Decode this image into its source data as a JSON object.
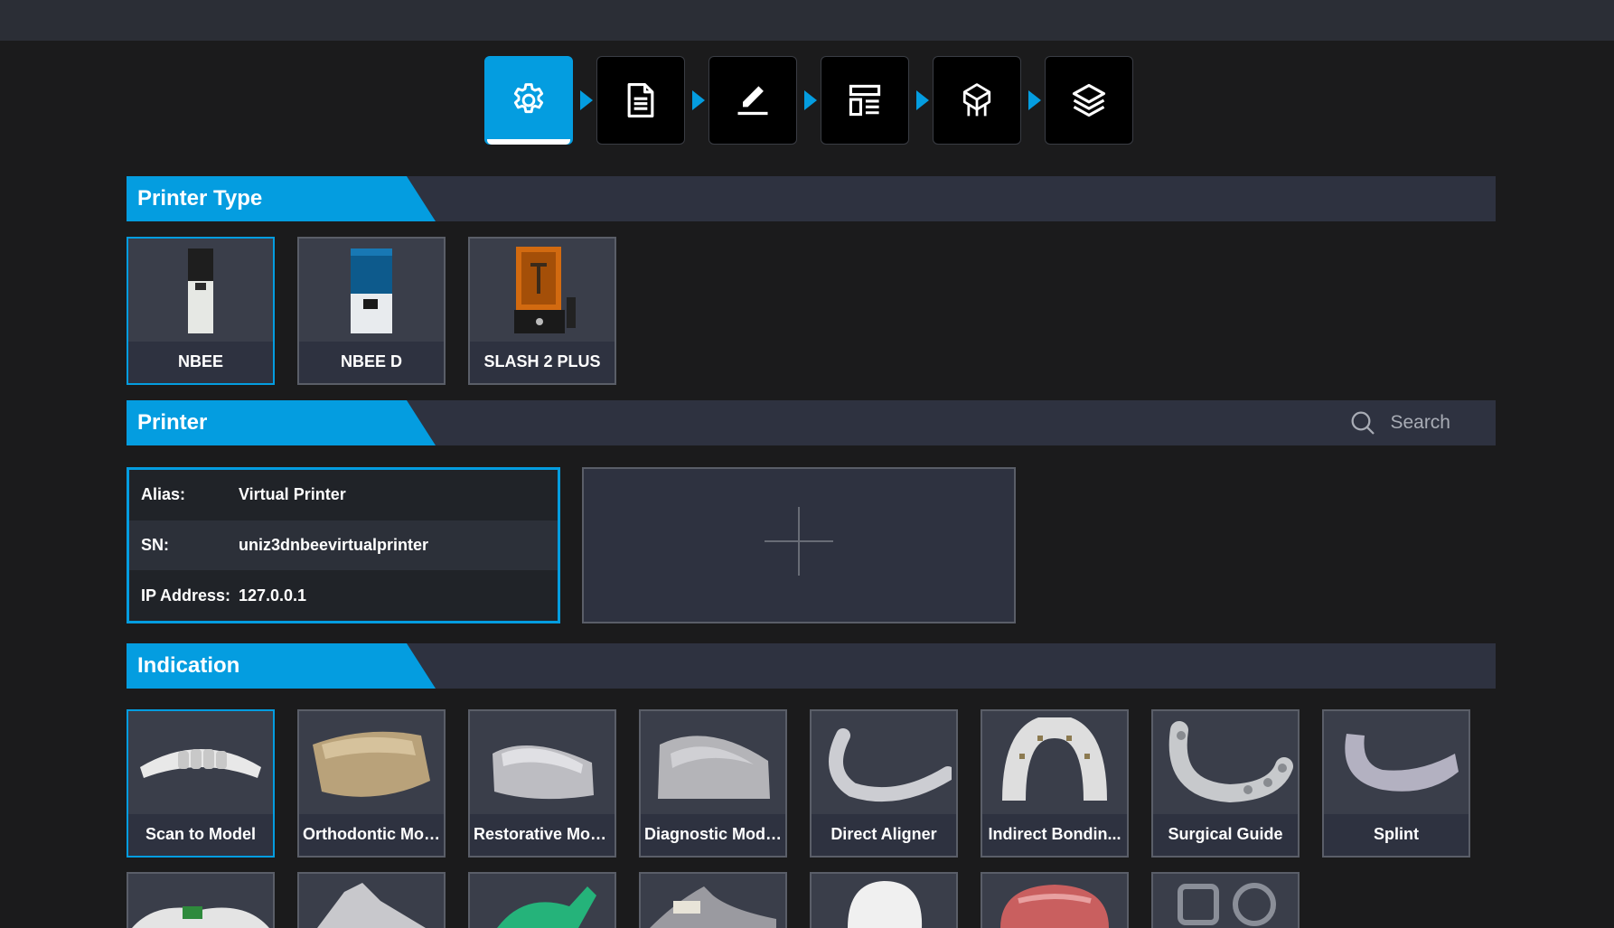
{
  "steps": [
    {
      "icon": "gear-icon",
      "active": true
    },
    {
      "icon": "document-icon",
      "active": false
    },
    {
      "icon": "pencil-icon",
      "active": false
    },
    {
      "icon": "layout-icon",
      "active": false
    },
    {
      "icon": "support-icon",
      "active": false
    },
    {
      "icon": "layers-icon",
      "active": false
    }
  ],
  "sections": {
    "printer_type": {
      "title": "Printer Type"
    },
    "printer": {
      "title": "Printer",
      "search_placeholder": "Search"
    },
    "indication": {
      "title": "Indication"
    }
  },
  "printer_types": [
    {
      "label": "NBEE",
      "selected": true
    },
    {
      "label": "NBEE D",
      "selected": false
    },
    {
      "label": "SLASH 2 PLUS",
      "selected": false
    }
  ],
  "printer_info": {
    "alias_label": "Alias:",
    "alias": "Virtual Printer",
    "sn_label": "SN:",
    "sn": "uniz3dnbeevirtualprinter",
    "ip_label": "IP Address:",
    "ip": "127.0.0.1"
  },
  "indications": [
    {
      "label": "Scan to Model",
      "selected": true
    },
    {
      "label": "Orthodontic Mod...",
      "selected": false
    },
    {
      "label": "Restorative Mod...",
      "selected": false
    },
    {
      "label": "Diagnostic Mode...",
      "selected": false
    },
    {
      "label": "Direct Aligner",
      "selected": false
    },
    {
      "label": "Indirect Bondin...",
      "selected": false
    },
    {
      "label": "Surgical Guide",
      "selected": false
    },
    {
      "label": "Splint",
      "selected": false
    }
  ],
  "colors": {
    "accent": "#049de0",
    "panel": "#2e3240",
    "background": "#1b1b1c"
  }
}
